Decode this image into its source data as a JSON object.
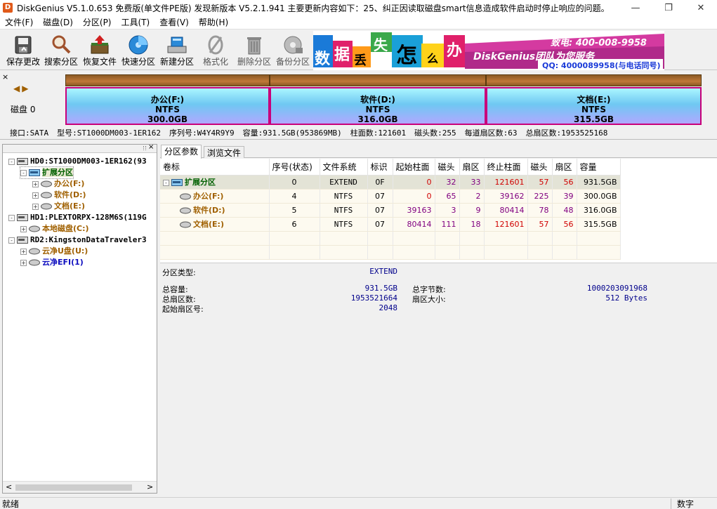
{
  "window": {
    "title": "DiskGenius V5.1.0.653 免费版(单文件PE版)   发现新版本 V5.2.1.941 主要更新内容如下：25、纠正因读取磁盘smart信息造成软件启动时停止响应的问题。",
    "icon_letter": "D"
  },
  "menu": [
    "文件(F)",
    "磁盘(D)",
    "分区(P)",
    "工具(T)",
    "查看(V)",
    "帮助(H)"
  ],
  "toolbar": [
    {
      "label": "保存更改",
      "icon": "save-icon"
    },
    {
      "label": "搜索分区",
      "icon": "search-partition-icon"
    },
    {
      "label": "恢复文件",
      "icon": "recover-files-icon"
    },
    {
      "label": "快速分区",
      "icon": "quick-partition-icon"
    },
    {
      "label": "新建分区",
      "icon": "new-partition-icon"
    },
    {
      "label": "格式化",
      "icon": "format-icon"
    },
    {
      "label": "删除分区",
      "icon": "delete-partition-icon"
    },
    {
      "label": "备份分区",
      "icon": "backup-partition-icon"
    }
  ],
  "banner": {
    "tiles": [
      "数",
      "据",
      "丢",
      "失",
      "怎",
      "么",
      "办"
    ],
    "headline": "DiskGenius团队为您服务",
    "phone": "致电: 400-008-9958",
    "qq": "QQ: 4000089958(与电话同号)"
  },
  "disk_map": {
    "label": "磁盘 0",
    "partitions": [
      {
        "name": "办公(F:)",
        "fs": "NTFS",
        "size": "300.0GB"
      },
      {
        "name": "软件(D:)",
        "fs": "NTFS",
        "size": "316.0GB"
      },
      {
        "name": "文档(E:)",
        "fs": "NTFS",
        "size": "315.5GB"
      }
    ]
  },
  "disk_info": {
    "interface": "接口:SATA",
    "model": "型号:ST1000DM003-1ER162",
    "serial": "序列号:W4Y4R9Y9",
    "capacity": "容量:931.5GB(953869MB)",
    "cylinders": "柱面数:121601",
    "heads": "磁头数:255",
    "sectors_per_track": "每道扇区数:63",
    "total_sectors": "总扇区数:1953525168"
  },
  "tree": [
    {
      "text": "HD0:ST1000DM003-1ER162(93",
      "kind": "disk",
      "expander": "-"
    },
    {
      "text": "扩展分区",
      "kind": "extended",
      "expander": "-"
    },
    {
      "text": "办公(F:)",
      "kind": "partition",
      "expander": "+"
    },
    {
      "text": "软件(D:)",
      "kind": "partition",
      "expander": "+"
    },
    {
      "text": "文档(E:)",
      "kind": "partition",
      "expander": "+"
    },
    {
      "text": "HD1:PLEXTORPX-128M6S(119G",
      "kind": "disk",
      "expander": "-"
    },
    {
      "text": "本地磁盘(C:)",
      "kind": "partition",
      "expander": "+"
    },
    {
      "text": "RD2:KingstonDataTraveler3",
      "kind": "disk",
      "expander": "-"
    },
    {
      "text": "云净U盘(U:)",
      "kind": "partition",
      "expander": "+"
    },
    {
      "text": "云净EFI(1)",
      "kind": "partition-blue",
      "expander": "+"
    }
  ],
  "tabs": [
    "分区参数",
    "浏览文件"
  ],
  "table": {
    "headers": [
      "卷标",
      "序号(状态)",
      "文件系统",
      "标识",
      "起始柱面",
      "磁头",
      "扇区",
      "终止柱面",
      "磁头",
      "扇区",
      "容量"
    ],
    "rows": [
      {
        "label": "扩展分区",
        "index": "0",
        "fs": "EXTEND",
        "id": "0F",
        "start_cyl": "0",
        "start_head": "32",
        "start_sec": "33",
        "end_cyl": "121601",
        "end_head": "57",
        "end_sec": "56",
        "capacity": "931.5GB"
      },
      {
        "label": "办公(F:)",
        "index": "4",
        "fs": "NTFS",
        "id": "07",
        "start_cyl": "0",
        "start_head": "65",
        "start_sec": "2",
        "end_cyl": "39162",
        "end_head": "225",
        "end_sec": "39",
        "capacity": "300.0GB"
      },
      {
        "label": "软件(D:)",
        "index": "5",
        "fs": "NTFS",
        "id": "07",
        "start_cyl": "39163",
        "start_head": "3",
        "start_sec": "9",
        "end_cyl": "80414",
        "end_head": "78",
        "end_sec": "48",
        "capacity": "316.0GB"
      },
      {
        "label": "文档(E:)",
        "index": "6",
        "fs": "NTFS",
        "id": "07",
        "start_cyl": "80414",
        "start_head": "111",
        "start_sec": "18",
        "end_cyl": "121601",
        "end_head": "57",
        "end_sec": "56",
        "capacity": "315.5GB"
      }
    ]
  },
  "detail": {
    "type_label": "分区类型:",
    "type_value": "EXTEND",
    "total_cap_label": "总容量:",
    "total_cap_value": "931.5GB",
    "total_sectors_label": "总扇区数:",
    "total_sectors_value": "1953521664",
    "start_sector_label": "起始扇区号:",
    "start_sector_value": "2048",
    "total_bytes_label": "总字节数:",
    "total_bytes_value": "1000203091968",
    "sector_size_label": "扇区大小:",
    "sector_size_value": "512 Bytes"
  },
  "status": {
    "left": "就绪",
    "right": "数字"
  },
  "colors": {
    "partition_border": "#c8007a",
    "partition_name": "#a06000",
    "extended_name": "#006000",
    "red_value": "#d00000",
    "blue_value": "#1010c0",
    "purple_value": "#800080"
  }
}
